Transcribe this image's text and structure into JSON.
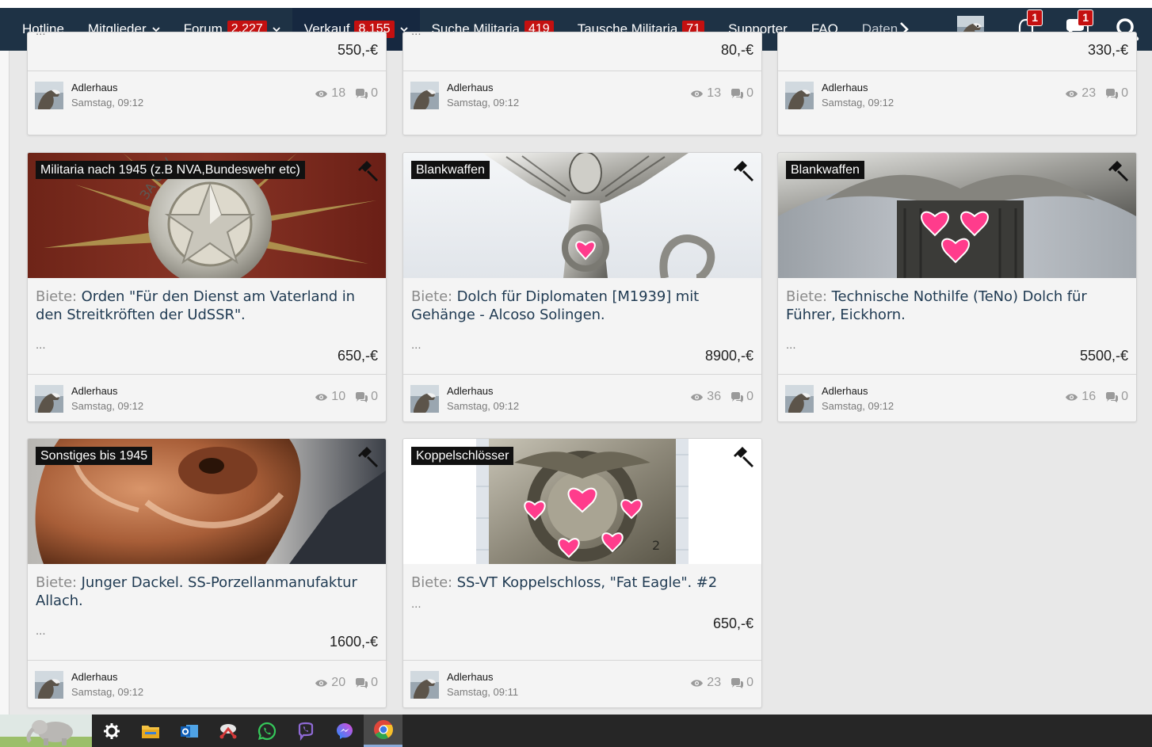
{
  "nav": {
    "items": [
      {
        "label": "Hotline"
      },
      {
        "label": "Mitglieder",
        "caret": true
      },
      {
        "label": "Forum",
        "badge": "2.227",
        "caret": true
      },
      {
        "label": "Verkauf",
        "badge": "8.155",
        "caret": true,
        "active": true
      },
      {
        "label": "Suche Militaria",
        "badge": "419"
      },
      {
        "label": "Tausche Militaria",
        "badge": "71"
      },
      {
        "label": "Supporter"
      },
      {
        "label": "FAQ"
      },
      {
        "label": "Daten"
      }
    ],
    "notifications_count": "1",
    "messages_count": "1"
  },
  "top_row": [
    {
      "ellipsis": "...",
      "price": "550,-€",
      "user": "Adlerhaus",
      "date": "Samstag, 09:12",
      "views": "18",
      "replies": "0"
    },
    {
      "ellipsis": "...",
      "price": "80,-€",
      "user": "Adlerhaus",
      "date": "Samstag, 09:12",
      "views": "13",
      "replies": "0"
    },
    {
      "ellipsis": "",
      "price": "330,-€",
      "user": "Adlerhaus",
      "date": "Samstag, 09:12",
      "views": "23",
      "replies": "0"
    }
  ],
  "listings": [
    {
      "category": "Militaria nach 1945 (z.B NVA,Bundeswehr etc)",
      "prefix": "Biete:",
      "title": "Orden \"Für den Dienst am Vaterland in den Streitkröften der UdSSR\".",
      "ellipsis": "...",
      "price": "650,-€",
      "user": "Adlerhaus",
      "date": "Samstag, 09:12",
      "views": "10",
      "replies": "0",
      "image": "medal"
    },
    {
      "category": "Blankwaffen",
      "prefix": "Biete:",
      "title": "Dolch für Diplomaten [M1939] mit Gehänge - Alcoso Solingen.",
      "ellipsis": "...",
      "price": "8900,-€",
      "user": "Adlerhaus",
      "date": "Samstag, 09:12",
      "views": "36",
      "replies": "0",
      "image": "eagle"
    },
    {
      "category": "Blankwaffen",
      "prefix": "Biete:",
      "title": "Technische Nothilfe (TeNo) Dolch für Führer, Eickhorn.",
      "ellipsis": "...",
      "price": "5500,-€",
      "user": "Adlerhaus",
      "date": "Samstag, 09:12",
      "views": "16",
      "replies": "0",
      "image": "dagger"
    },
    {
      "category": "Sonstiges bis 1945",
      "prefix": "Biete:",
      "title": "Junger Dackel. SS-Porzellanmanufaktur Allach.",
      "ellipsis": "...",
      "price": "1600,-€",
      "user": "Adlerhaus",
      "date": "Samstag, 09:12",
      "views": "20",
      "replies": "0",
      "image": "dog"
    },
    {
      "category": "Koppelschlösser",
      "prefix": "Biete:",
      "title": "SS-VT Koppelschloss, \"Fat Eagle\". #2",
      "ellipsis": "...",
      "price": "650,-€",
      "user": "Adlerhaus",
      "date": "Samstag, 09:11",
      "views": "23",
      "replies": "0",
      "image": "buckle"
    }
  ],
  "taskbar": {
    "icons": [
      "settings-icon",
      "file-explorer-icon",
      "outlook-icon",
      "snipping-tool-icon",
      "whatsapp-icon",
      "viber-icon",
      "messenger-icon",
      "chrome-icon"
    ]
  },
  "colors": {
    "nav_bg": "#1e3245",
    "badge_red": "#c41010",
    "title_blue": "#1f3a52",
    "page_bg": "#e8e8e8"
  }
}
